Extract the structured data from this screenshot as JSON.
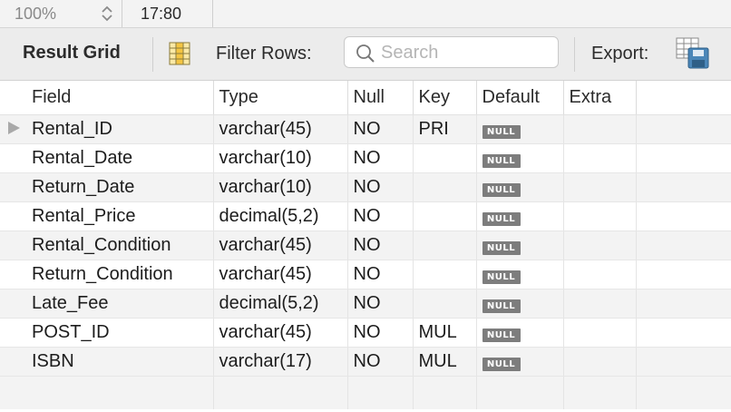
{
  "topbar": {
    "zoom": "100%",
    "time": "17:80"
  },
  "toolbar": {
    "result_grid_label": "Result Grid",
    "filter_label": "Filter Rows:",
    "search_placeholder": "Search",
    "export_label": "Export:"
  },
  "grid": {
    "columns": [
      "Field",
      "Type",
      "Null",
      "Key",
      "Default",
      "Extra"
    ],
    "rows": [
      {
        "field": "Rental_ID",
        "type": "varchar(45)",
        "null": "NO",
        "key": "PRI",
        "default": "NULL",
        "extra": ""
      },
      {
        "field": "Rental_Date",
        "type": "varchar(10)",
        "null": "NO",
        "key": "",
        "default": "NULL",
        "extra": ""
      },
      {
        "field": "Return_Date",
        "type": "varchar(10)",
        "null": "NO",
        "key": "",
        "default": "NULL",
        "extra": ""
      },
      {
        "field": "Rental_Price",
        "type": "decimal(5,2)",
        "null": "NO",
        "key": "",
        "default": "NULL",
        "extra": ""
      },
      {
        "field": "Rental_Condition",
        "type": "varchar(45)",
        "null": "NO",
        "key": "",
        "default": "NULL",
        "extra": ""
      },
      {
        "field": "Return_Condition",
        "type": "varchar(45)",
        "null": "NO",
        "key": "",
        "default": "NULL",
        "extra": ""
      },
      {
        "field": "Late_Fee",
        "type": "decimal(5,2)",
        "null": "NO",
        "key": "",
        "default": "NULL",
        "extra": ""
      },
      {
        "field": "POST_ID",
        "type": "varchar(45)",
        "null": "NO",
        "key": "MUL",
        "default": "NULL",
        "extra": ""
      },
      {
        "field": "ISBN",
        "type": "varchar(17)",
        "null": "NO",
        "key": "MUL",
        "default": "NULL",
        "extra": ""
      }
    ]
  },
  "icons": {
    "stepper": "chevron-up-down-icon",
    "grid_toggle": "grid-columns-icon",
    "search": "search-icon",
    "export": "export-save-icon",
    "row_marker": "row-pointer-icon"
  },
  "colors": {
    "null_badge": "#7d7d7d",
    "stripe": "#f3f3f3",
    "export_icon": "#4a86b8"
  }
}
